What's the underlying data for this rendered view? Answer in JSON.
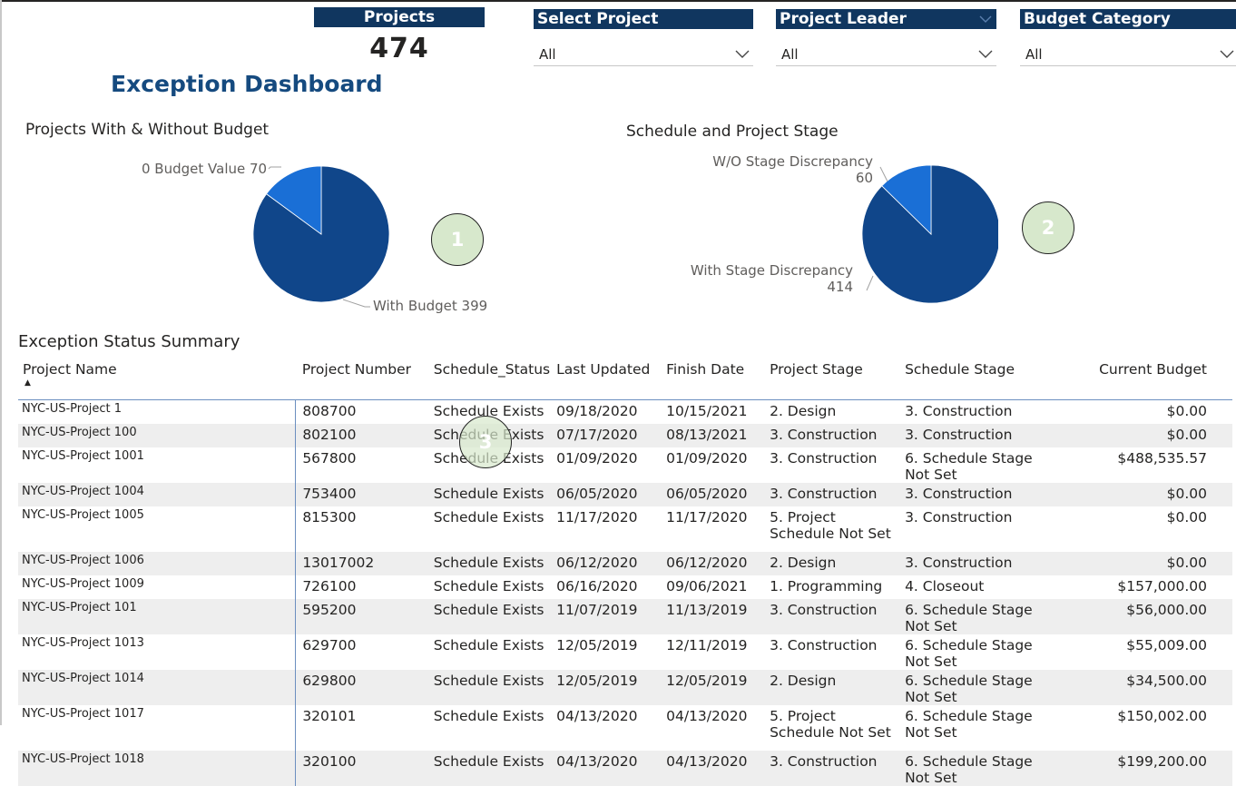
{
  "card": {
    "header": "Projects",
    "value": "474"
  },
  "slicers": [
    {
      "header": "Select Project",
      "selected": "All"
    },
    {
      "header": "Project Leader",
      "selected": "All"
    },
    {
      "header": "Budget Category",
      "selected": "All"
    }
  ],
  "dashboard_title": "Exception Dashboard",
  "chart_data": [
    {
      "type": "pie",
      "title": "Projects With & Without Budget",
      "labels": [
        "0 Budget Value",
        "With Budget"
      ],
      "values": [
        70,
        399
      ],
      "label_texts": [
        "0 Budget Value 70",
        "With Budget 399"
      ],
      "colors": [
        "#1a6fd6",
        "#10468a"
      ]
    },
    {
      "type": "pie",
      "title": "Schedule and Project Stage",
      "labels": [
        "W/O Stage Discrepancy",
        "With Stage Discrepancy"
      ],
      "values": [
        60,
        414
      ],
      "colors": [
        "#1a6fd6",
        "#10468a"
      ]
    }
  ],
  "callouts": [
    "1",
    "2",
    "3"
  ],
  "table": {
    "title": "Exception Status Summary",
    "columns": [
      "Project Name",
      "Project Number",
      "Schedule_Status",
      "Last Updated",
      "Finish Date",
      "Project Stage",
      "Schedule Stage",
      "Current Budget"
    ],
    "rows": [
      [
        "NYC-US-Project 1",
        "808700",
        "Schedule Exists",
        "09/18/2020",
        "10/15/2021",
        "2. Design",
        "3. Construction",
        "$0.00"
      ],
      [
        "NYC-US-Project 100",
        "802100",
        "Schedule Exists",
        "07/17/2020",
        "08/13/2021",
        "3. Construction",
        "3. Construction",
        "$0.00"
      ],
      [
        "NYC-US-Project 1001",
        "567800",
        "Schedule Exists",
        "01/09/2020",
        "01/09/2020",
        "3. Construction",
        "6. Schedule Stage Not Set",
        "$488,535.57"
      ],
      [
        "NYC-US-Project 1004",
        "753400",
        "Schedule Exists",
        "06/05/2020",
        "06/05/2020",
        "3. Construction",
        "3. Construction",
        "$0.00"
      ],
      [
        "NYC-US-Project 1005",
        "815300",
        "Schedule Exists",
        "11/17/2020",
        "11/17/2020",
        "5. Project Schedule Not Set",
        "3. Construction",
        "$0.00"
      ],
      [
        "NYC-US-Project 1006",
        "13017002",
        "Schedule Exists",
        "06/12/2020",
        "06/12/2020",
        "2. Design",
        "3. Construction",
        "$0.00"
      ],
      [
        "NYC-US-Project 1009",
        "726100",
        "Schedule Exists",
        "06/16/2020",
        "09/06/2021",
        "1. Programming",
        "4. Closeout",
        "$157,000.00"
      ],
      [
        "NYC-US-Project 101",
        "595200",
        "Schedule Exists",
        "11/07/2019",
        "11/13/2019",
        "3. Construction",
        "6. Schedule Stage Not Set",
        "$56,000.00"
      ],
      [
        "NYC-US-Project 1013",
        "629700",
        "Schedule Exists",
        "12/05/2019",
        "12/11/2019",
        "3. Construction",
        "6. Schedule Stage Not Set",
        "$55,009.00"
      ],
      [
        "NYC-US-Project 1014",
        "629800",
        "Schedule Exists",
        "12/05/2019",
        "12/05/2019",
        "2. Design",
        "6. Schedule Stage Not Set",
        "$34,500.00"
      ],
      [
        "NYC-US-Project 1017",
        "320101",
        "Schedule Exists",
        "04/13/2020",
        "04/13/2020",
        "5. Project Schedule Not Set",
        "6. Schedule Stage Not Set",
        "$150,002.00"
      ],
      [
        "NYC-US-Project 1018",
        "320100",
        "Schedule Exists",
        "04/13/2020",
        "04/13/2020",
        "3. Construction",
        "6. Schedule Stage Not Set",
        "$199,200.00"
      ]
    ]
  }
}
